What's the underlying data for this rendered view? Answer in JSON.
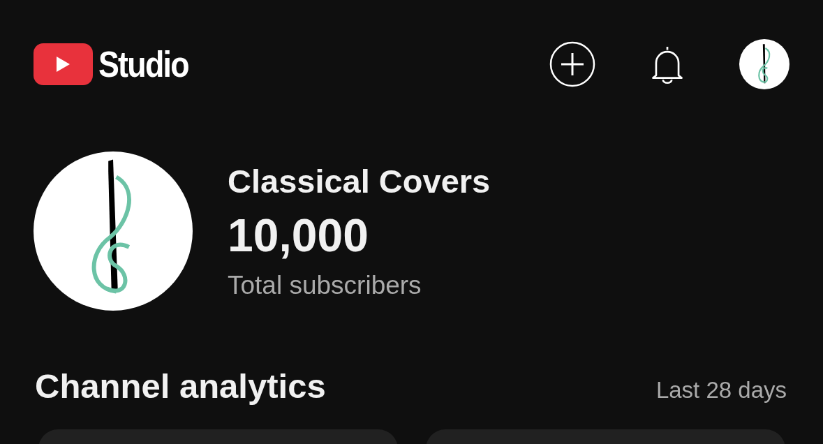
{
  "header": {
    "app_name": "Studio"
  },
  "channel": {
    "name": "Classical Covers",
    "subscribers": "10,000",
    "subscribers_label": "Total subscribers"
  },
  "analytics": {
    "title": "Channel analytics",
    "period": "Last 28 days"
  }
}
